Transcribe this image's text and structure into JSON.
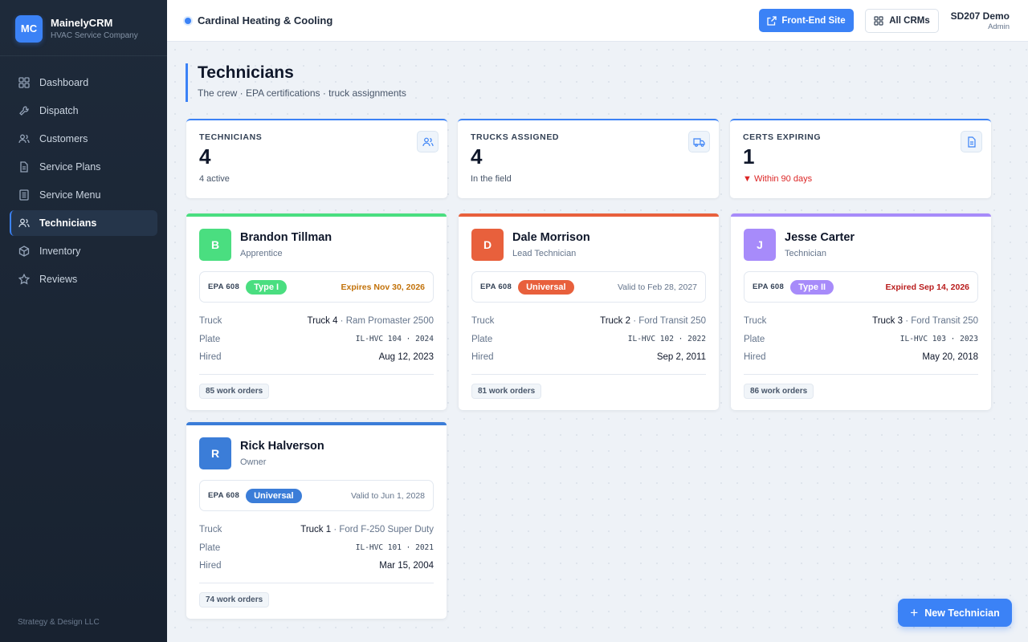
{
  "brand": {
    "logo": "MC",
    "name": "MainelyCRM",
    "subtitle": "HVAC Service Company"
  },
  "nav": [
    {
      "label": "Dashboard",
      "icon": "grid-icon"
    },
    {
      "label": "Dispatch",
      "icon": "wrench-icon"
    },
    {
      "label": "Customers",
      "icon": "users-icon"
    },
    {
      "label": "Service Plans",
      "icon": "document-icon"
    },
    {
      "label": "Service Menu",
      "icon": "list-icon"
    },
    {
      "label": "Technicians",
      "icon": "users-icon",
      "active": true
    },
    {
      "label": "Inventory",
      "icon": "box-icon"
    },
    {
      "label": "Reviews",
      "icon": "star-icon"
    }
  ],
  "footer": "Strategy & Design LLC",
  "topbar": {
    "company": "Cardinal Heating & Cooling",
    "front_end": "Front-End Site",
    "all_crms": "All CRMs",
    "user_name": "SD207 Demo",
    "user_role": "Admin"
  },
  "page": {
    "title": "Technicians",
    "subtitle": "The crew · EPA certifications · truck assignments"
  },
  "stats": [
    {
      "label": "TECHNICIANS",
      "value": "4",
      "note": "4 active",
      "icon": "users-icon"
    },
    {
      "label": "TRUCKS ASSIGNED",
      "value": "4",
      "note": "In the field",
      "icon": "truck-icon"
    },
    {
      "label": "CERTS EXPIRING",
      "value": "1",
      "note": "▼ Within 90 days",
      "icon": "document-icon",
      "note_color": "#dc2626"
    }
  ],
  "labels": {
    "epa": "EPA 608",
    "truck": "Truck",
    "plate": "Plate",
    "hired": "Hired"
  },
  "technicians": [
    {
      "initial": "B",
      "name": "Brandon Tillman",
      "role": "Apprentice",
      "color": "#4ade80",
      "cert": "Type I",
      "cert_color": "#4ade80",
      "expiry": "Expires Nov 30, 2026",
      "expiry_status": "warning",
      "truck": "Truck 4",
      "truck_model": "· Ram Promaster 2500",
      "plate": "IL-HVC 104 · 2024",
      "hired": "Aug 12, 2023",
      "work_orders": "85 work orders"
    },
    {
      "initial": "D",
      "name": "Dale Morrison",
      "role": "Lead Technician",
      "color": "#e8603c",
      "cert": "Universal",
      "cert_color": "#e8603c",
      "expiry": "Valid to Feb 28, 2027",
      "expiry_status": "valid",
      "truck": "Truck 2",
      "truck_model": "· Ford Transit 250",
      "plate": "IL-HVC 102 · 2022",
      "hired": "Sep 2, 2011",
      "work_orders": "81 work orders"
    },
    {
      "initial": "J",
      "name": "Jesse Carter",
      "role": "Technician",
      "color": "#a78bfa",
      "cert": "Type II",
      "cert_color": "#a78bfa",
      "expiry": "Expired Sep 14, 2026",
      "expiry_status": "expired",
      "truck": "Truck 3",
      "truck_model": "· Ford Transit 250",
      "plate": "IL-HVC 103 · 2023",
      "hired": "May 20, 2018",
      "work_orders": "86 work orders"
    },
    {
      "initial": "R",
      "name": "Rick Halverson",
      "role": "Owner",
      "color": "#3b7dd8",
      "cert": "Universal",
      "cert_color": "#3b7dd8",
      "expiry": "Valid to Jun 1, 2028",
      "expiry_status": "valid",
      "truck": "Truck 1",
      "truck_model": "· Ford F-250 Super Duty",
      "plate": "IL-HVC 101 · 2021",
      "hired": "Mar 15, 2004",
      "work_orders": "74 work orders"
    }
  ],
  "fab": "New Technician"
}
